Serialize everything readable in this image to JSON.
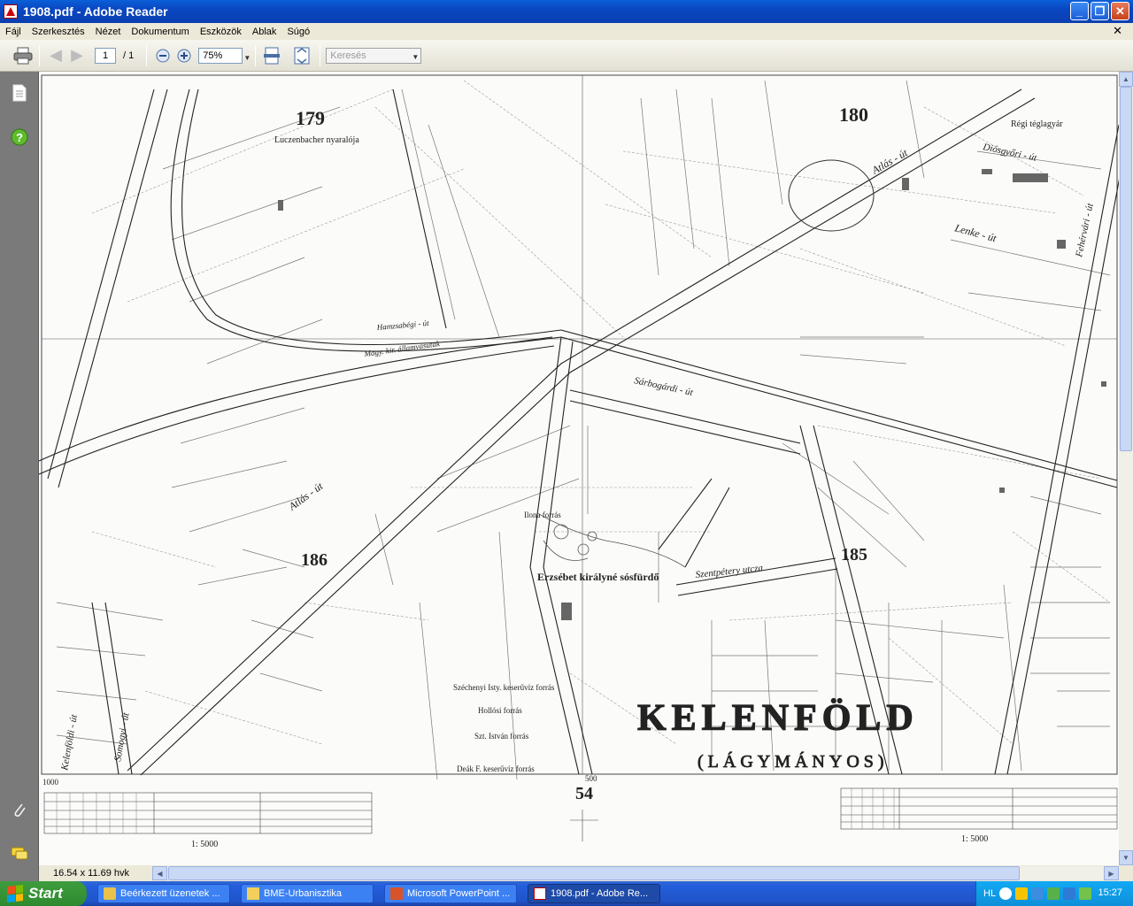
{
  "window": {
    "title": "1908.pdf - Adobe Reader"
  },
  "menu": [
    "Fájl",
    "Szerkesztés",
    "Nézet",
    "Dokumentum",
    "Eszközök",
    "Ablak",
    "Súgó"
  ],
  "toolbar": {
    "page_current": "1",
    "page_total": "/ 1",
    "zoom": "75%",
    "search_placeholder": "Keresés"
  },
  "status": {
    "page_size": "16.54 x 11.69 hvk"
  },
  "map": {
    "labels": {
      "block_179": "179",
      "block_180": "180",
      "block_185": "185",
      "block_186": "186",
      "sheet_no": "54",
      "scale_left": "1: 5000",
      "scale_right": "1: 5000",
      "district": "KELENFÖLD",
      "district_sub": "(LÁGYMÁNYOS)",
      "luczenbacher": "Luczenbacher nyaralója",
      "regi_teglagyar": "Régi téglagyár",
      "erzsebet": "Erzsébet királyné sósfürdő",
      "ilona": "Ilona forrás",
      "szechenyi": "Széchenyi Isty. keserűvíz forrás",
      "hollosi": "Hollósi forrás",
      "szt_istvan": "Szt. István forrás",
      "deak": "Deák F. keserűvíz forrás",
      "atlas_ut_1": "Atlás - út",
      "atlas_ut_2": "Atlás - út",
      "lenke_ut": "Lenke - út",
      "diosgyori_ut": "Diósgyőri - út",
      "szentpetery": "Szentpétery utcza",
      "sarbogardi": "Sárbogárdi - út",
      "kelenfold_ut": "Kelenföldi - út",
      "somogyi_ut": "Somogyi - út",
      "fehervari": "Fehérvári - út",
      "mav": "Magy. kir. államvasutak",
      "hamzsabegi": "Hamzsabégi - út",
      "tick_1000": "1000",
      "tick_500": "500"
    }
  },
  "taskbar": {
    "start": "Start",
    "tasks": [
      "Beérkezett üzenetek ...",
      "BME-Urbanisztika",
      "Microsoft PowerPoint ...",
      "1908.pdf - Adobe Re..."
    ],
    "lang": "HL",
    "clock": "15:27"
  }
}
